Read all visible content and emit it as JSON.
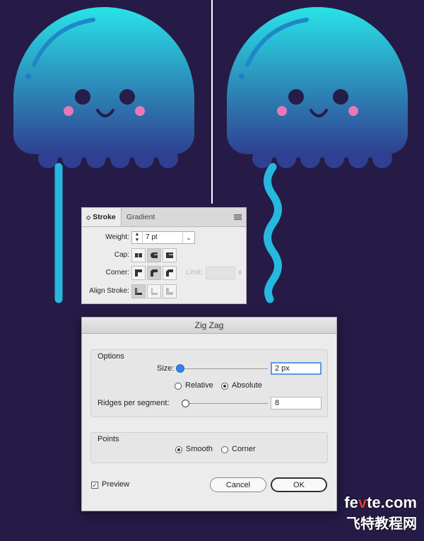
{
  "colors": {
    "background": "#251b46",
    "jelly_top": "#29e3e8",
    "jelly_bottom": "#2f3f91",
    "tentacle": "#26b8de",
    "cheek": "#e779b7",
    "accent_blue": "#2f82e5"
  },
  "stroke_panel": {
    "tabs": [
      {
        "label": "Stroke",
        "active": true
      },
      {
        "label": "Gradient",
        "active": false
      }
    ],
    "weight": {
      "label": "Weight:",
      "value": "7 pt"
    },
    "cap": {
      "label": "Cap:",
      "icons": [
        "butt-cap-icon",
        "round-cap-icon",
        "projecting-cap-icon"
      ],
      "selected": 1
    },
    "corner": {
      "label": "Corner:",
      "icons": [
        "miter-join-icon",
        "round-join-icon",
        "bevel-join-icon"
      ],
      "selected": 1
    },
    "limit": {
      "label": "Limit:",
      "suffix": "x"
    },
    "align": {
      "label": "Align Stroke:",
      "icons": [
        "align-center-icon",
        "align-inside-icon",
        "align-outside-icon"
      ],
      "selected": 0
    }
  },
  "zigzag": {
    "title": "Zig Zag",
    "options": {
      "title": "Options",
      "size": {
        "label": "Size:",
        "value": "2 px",
        "slider_fraction": 0.0
      },
      "mode": {
        "options": [
          "Relative",
          "Absolute"
        ],
        "selected": "Absolute"
      },
      "ridges": {
        "label": "Ridges per segment:",
        "value": "8",
        "slider_fraction": 0.0
      }
    },
    "points": {
      "title": "Points",
      "options": [
        "Smooth",
        "Corner"
      ],
      "selected": "Smooth"
    },
    "preview": {
      "label": "Preview",
      "checked": true,
      "mark": "✓"
    },
    "buttons": {
      "cancel": "Cancel",
      "ok": "OK"
    }
  },
  "watermark": {
    "line1_a": "fe",
    "line1_b": "v",
    "line1_c": "te.com",
    "line2": "飞特教程网"
  }
}
